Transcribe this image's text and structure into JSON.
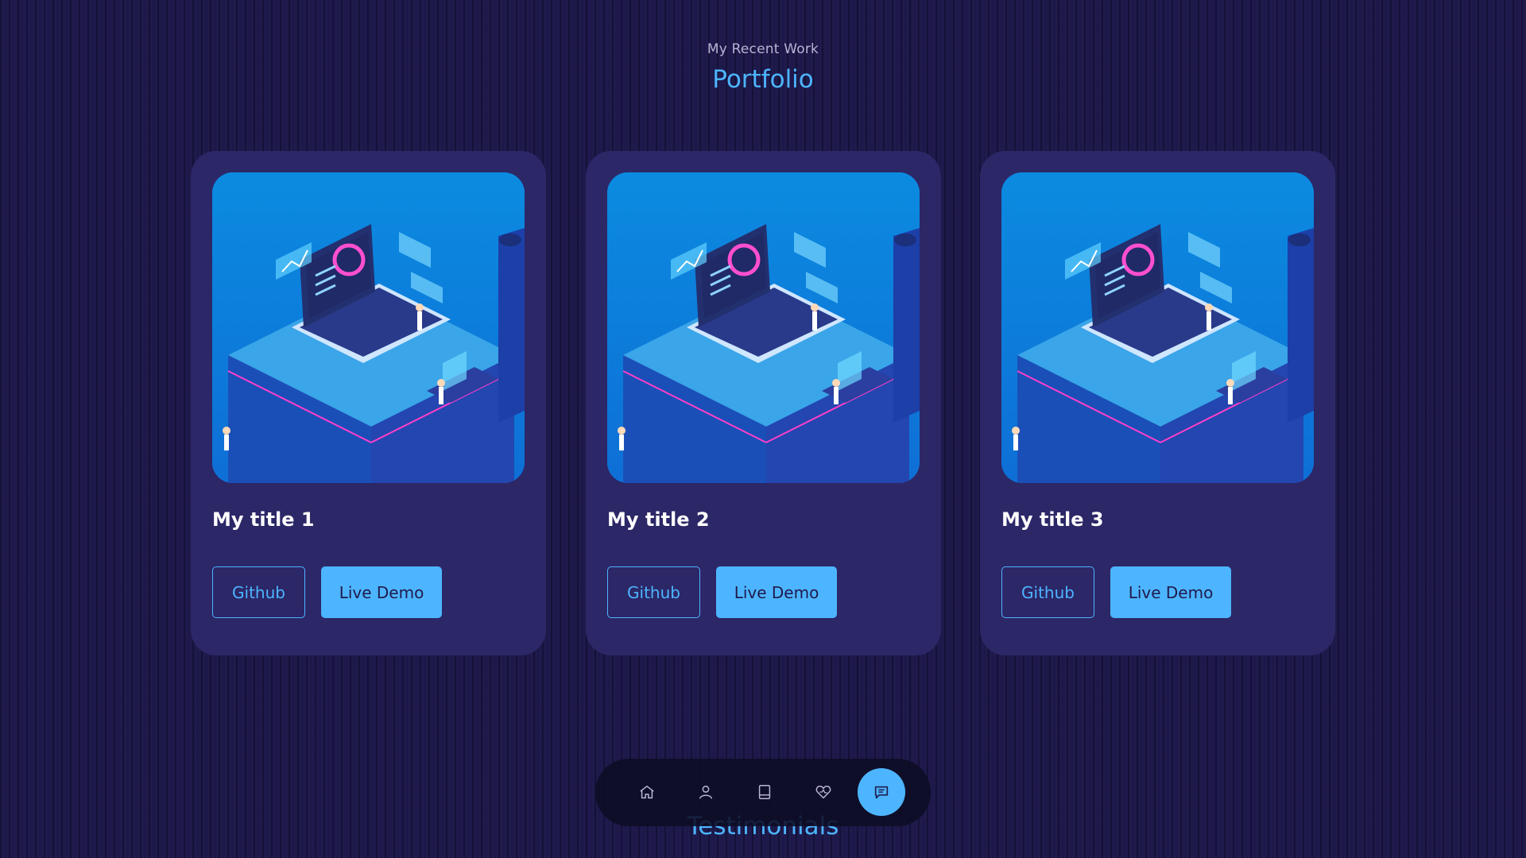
{
  "header": {
    "subtitle": "My Recent Work",
    "title": "Portfolio"
  },
  "projects": [
    {
      "title": "My title 1",
      "github_label": "Github",
      "demo_label": "Live Demo"
    },
    {
      "title": "My title 2",
      "github_label": "Github",
      "demo_label": "Live Demo"
    },
    {
      "title": "My title 3",
      "github_label": "Github",
      "demo_label": "Live Demo"
    }
  ],
  "next_section_title": "Testimonials",
  "nav": {
    "items": [
      {
        "icon": "home-icon"
      },
      {
        "icon": "user-icon"
      },
      {
        "icon": "book-icon"
      },
      {
        "icon": "services-icon"
      },
      {
        "icon": "message-icon",
        "active": true
      }
    ]
  },
  "colors": {
    "accent": "#4db5ff",
    "background": "#1f1a4c",
    "card": "#2c2767",
    "text": "#ffffff"
  }
}
